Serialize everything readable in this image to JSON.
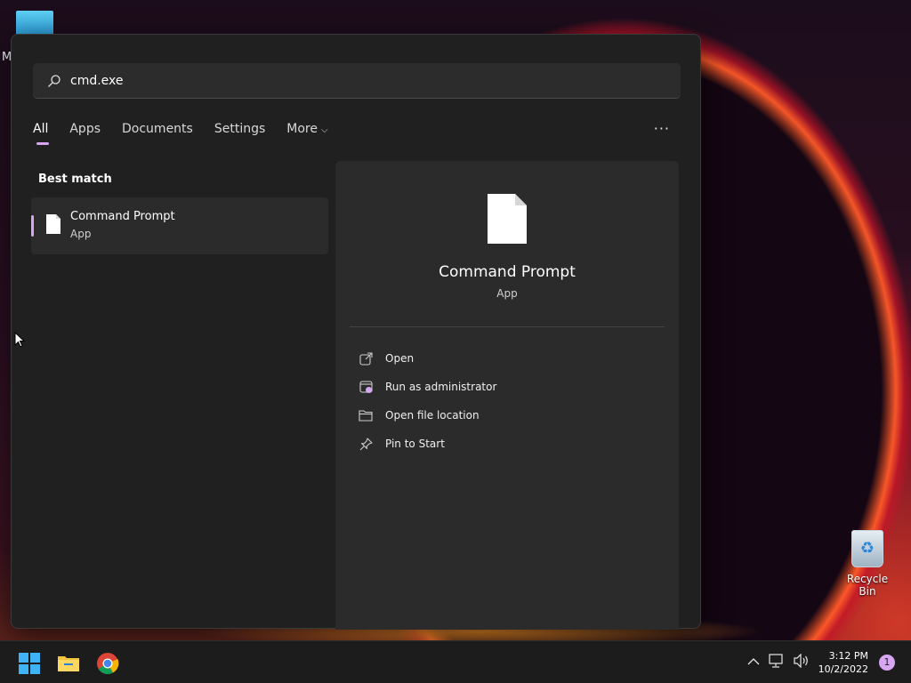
{
  "desktop": {
    "top_left_letter": "M",
    "recycle_bin_label": "Recycle Bin"
  },
  "search": {
    "query": "cmd.exe",
    "icon": "search-icon"
  },
  "tabs": [
    {
      "label": "All",
      "active": true
    },
    {
      "label": "Apps",
      "active": false
    },
    {
      "label": "Documents",
      "active": false
    },
    {
      "label": "Settings",
      "active": false
    },
    {
      "label": "More",
      "active": false
    }
  ],
  "more_options_glyph": "···",
  "best_match": {
    "section_label": "Best match",
    "item": {
      "title": "Command Prompt",
      "subtitle": "App",
      "icon": "file-icon"
    }
  },
  "detail": {
    "title": "Command Prompt",
    "subtitle": "App",
    "actions": [
      {
        "label": "Open",
        "icon": "open-external-icon"
      },
      {
        "label": "Run as administrator",
        "icon": "run-as-admin-icon"
      },
      {
        "label": "Open file location",
        "icon": "folder-icon"
      },
      {
        "label": "Pin to Start",
        "icon": "pin-icon"
      }
    ]
  },
  "taskbar": {
    "apps": [
      "start-icon",
      "file-explorer-icon",
      "chrome-icon"
    ],
    "clock_time": "3:12 PM",
    "clock_date": "10/2/2022",
    "notification_count": "1"
  },
  "colors": {
    "accent": "#d7a6f2",
    "flyout_bg": "#202020",
    "panel_bg": "#2b2b2b"
  }
}
